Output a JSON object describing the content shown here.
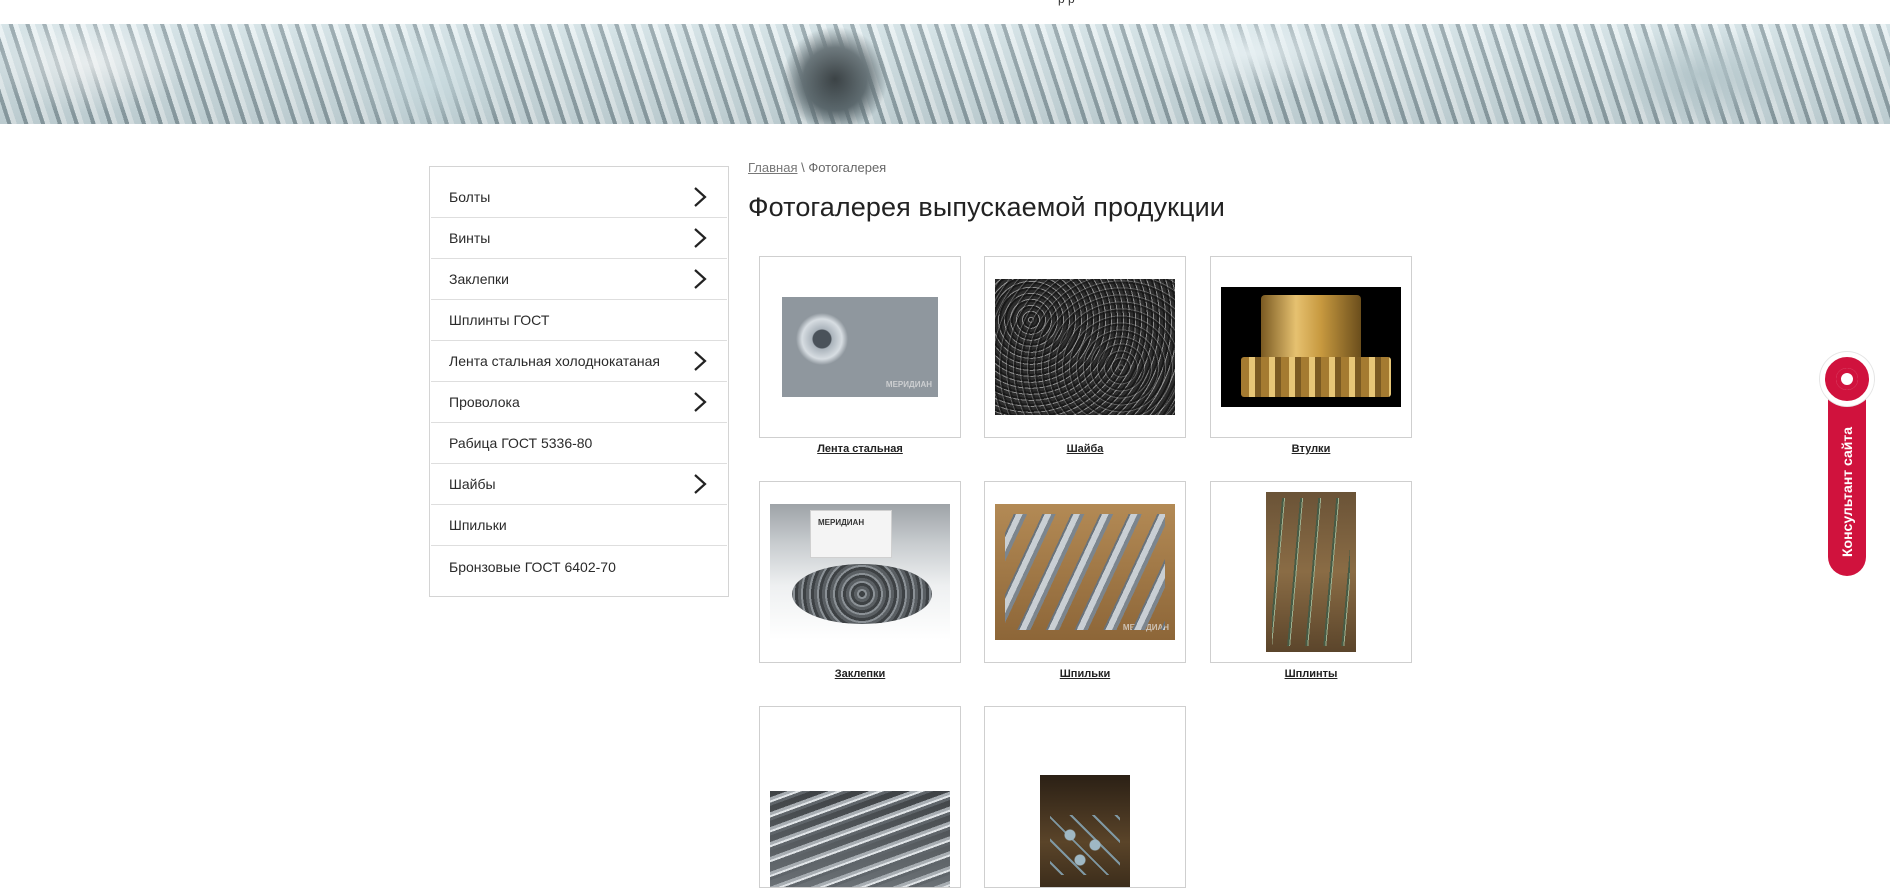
{
  "header": {
    "cut_text": "р  р"
  },
  "sidebar": {
    "items": [
      {
        "label": "Болты",
        "has_submenu": true
      },
      {
        "label": "Винты",
        "has_submenu": true
      },
      {
        "label": "Заклепки",
        "has_submenu": true
      },
      {
        "label": "Шплинты ГОСТ",
        "has_submenu": false
      },
      {
        "label": "Лента стальная холоднокатаная",
        "has_submenu": true
      },
      {
        "label": "Проволока",
        "has_submenu": true
      },
      {
        "label": "Рабица ГОСТ 5336-80",
        "has_submenu": false
      },
      {
        "label": "Шайбы",
        "has_submenu": true
      },
      {
        "label": "Шпильки",
        "has_submenu": false
      },
      {
        "label": "Бронзовые ГОСТ 6402-70",
        "has_submenu": false
      }
    ]
  },
  "breadcrumb": {
    "home": "Главная",
    "separator": "\\",
    "current": "Фотогалерея"
  },
  "page_title": "Фотогалерея выпускаемой продукции",
  "gallery": {
    "items": [
      {
        "caption": "Лента стальная",
        "image": "steel-coils",
        "watermark": "МЕРИДИАН"
      },
      {
        "caption": "Шайба",
        "image": "washers"
      },
      {
        "caption": "Втулки",
        "image": "bronze-bushings"
      },
      {
        "caption": "Заклепки",
        "image": "rivets",
        "watermark": "МЕРИДИАН"
      },
      {
        "caption": "Шпильки",
        "image": "studs",
        "watermark": "МЕРИДИАН"
      },
      {
        "caption": "Шплинты",
        "image": "cotter-pins"
      },
      {
        "caption": "",
        "image": "bolts"
      },
      {
        "caption": "",
        "image": "screws"
      }
    ]
  },
  "consultant": {
    "label": "Консультант сайта",
    "color": "#d0123d"
  }
}
